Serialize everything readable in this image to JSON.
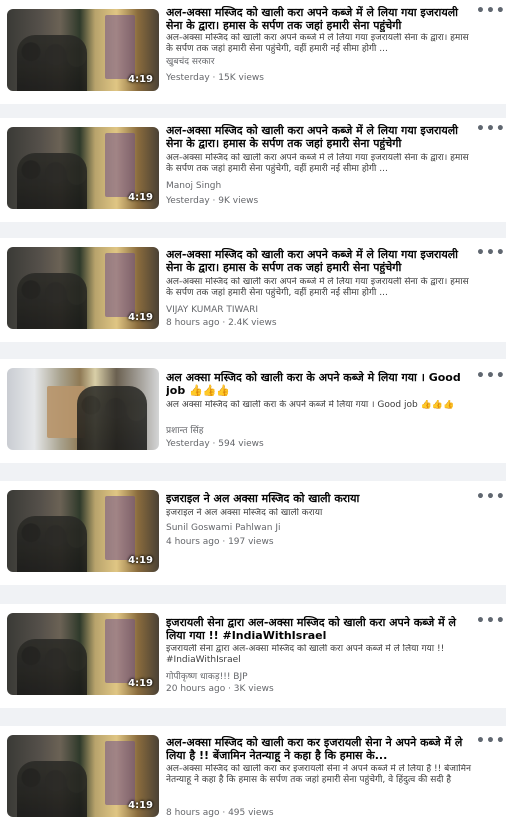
{
  "videos": [
    {
      "title": "अल-अक्सा मस्जिद को खाली करा अपने कब्जे में ले लिया गया इजरायली सेना के द्वारा। हमास के सर्पण तक जहां हमारी सेना पहुंचेगी",
      "description": "अल-अक्सा मस्जिद को खाली करा अपने कब्जे में ले लिया गया इजरायली सेना के द्वारा। हमास के सर्पण तक जहां हमारी सेना पहुंचेगी, वहीं हमारी नई सीमा होगी ...",
      "author": "खुबचंद सरकार",
      "meta": "Yesterday · 15K views",
      "duration": "4:19",
      "thumb_icon": "video-thumbnail"
    },
    {
      "title": "अल-अक्सा मस्जिद को खाली करा अपने कब्जे में ले लिया गया इजरायली सेना के द्वारा। हमास के सर्पण तक जहां हमारी सेना पहुंचेगी",
      "description": "अल-अक्सा मस्जिद को खाली करा अपने कब्जे में ले लिया गया इजरायली सेना के द्वारा। हमास के सर्पण तक जहां हमारी सेना पहुंचेगी, वहीं हमारी नई सीमा होगी ...",
      "author": "Manoj Singh",
      "meta": "Yesterday · 9K views",
      "duration": "4:19",
      "thumb_icon": "video-thumbnail"
    },
    {
      "title": "अल-अक्सा मस्जिद को खाली करा अपने कब्जे में ले लिया गया इजरायली सेना के द्वारा। हमास के सर्पण तक जहां हमारी सेना पहुंचेगी",
      "description": "अल-अक्सा मस्जिद को खाली करा अपने कब्जे में ले लिया गया इजरायली सेना के द्वारा। हमास के सर्पण तक जहां हमारी सेना पहुंचेगी, वहीं हमारी नई सीमा होगी ...",
      "author": "VIJAY KUMAR TIWARI",
      "meta": "8 hours ago · 2.4K views",
      "duration": "4:19",
      "thumb_icon": "video-thumbnail"
    },
    {
      "title": "अल अक्सा मस्जिद को खाली करा के अपने कब्जे मे लिया गया । Good job 👍👍👍",
      "description": "अल अक्सा मस्जिद को खाली करा के अपने कब्जे मे लिया गया । Good job 👍👍👍",
      "author": "प्रशान्त सिंह",
      "meta": "Yesterday · 594 views",
      "duration": "",
      "thumb_icon": "video-thumbnail"
    },
    {
      "title": "इजराइल ने अल अक्सा मस्जिद को खाली कराया",
      "description": "इजराइल ने अल अक्सा मस्जिद को खाली कराया",
      "author": "Sunil Goswami Pahlwan Ji",
      "meta": "4 hours ago · 197 views",
      "duration": "4:19",
      "thumb_icon": "video-thumbnail"
    },
    {
      "title": "इजरायली सेना द्वारा अल-अक्सा मस्जिद को खाली करा अपने कब्जे में ले लिया गया !! #IndiaWithIsrael",
      "description": "इजरायली सेना द्वारा अल-अक्सा मस्जिद को खाली करा अपने कब्जे में ले लिया गया !! #IndiaWithIsrael",
      "author": "गोपीकृष्ण धाकड़!!! BJP",
      "meta": "20 hours ago · 3K views",
      "duration": "4:19",
      "thumb_icon": "video-thumbnail"
    },
    {
      "title": "अल-अक्सा मस्जिद को खाली करा कर इजरायली सेना ने अपने कब्जे में ले लिया है !! बेंजामिन नेतन्याहू ने कहा है कि हमास के...",
      "description": "अल-अक्सा मस्जिद को खाली करा कर इजरायली सेना ने अपने कब्जे में ले लिया है !! बेंजामिन नेतन्याहू ने कहा है कि हमास के सर्पण तक जहां हमारी सेना पहुंचेगी, वे हिंदुत्व की सदी है",
      "author": "",
      "meta": "8 hours ago · 495 views",
      "duration": "4:19",
      "thumb_icon": "video-thumbnail"
    }
  ],
  "more_icon": "more-options-icon"
}
